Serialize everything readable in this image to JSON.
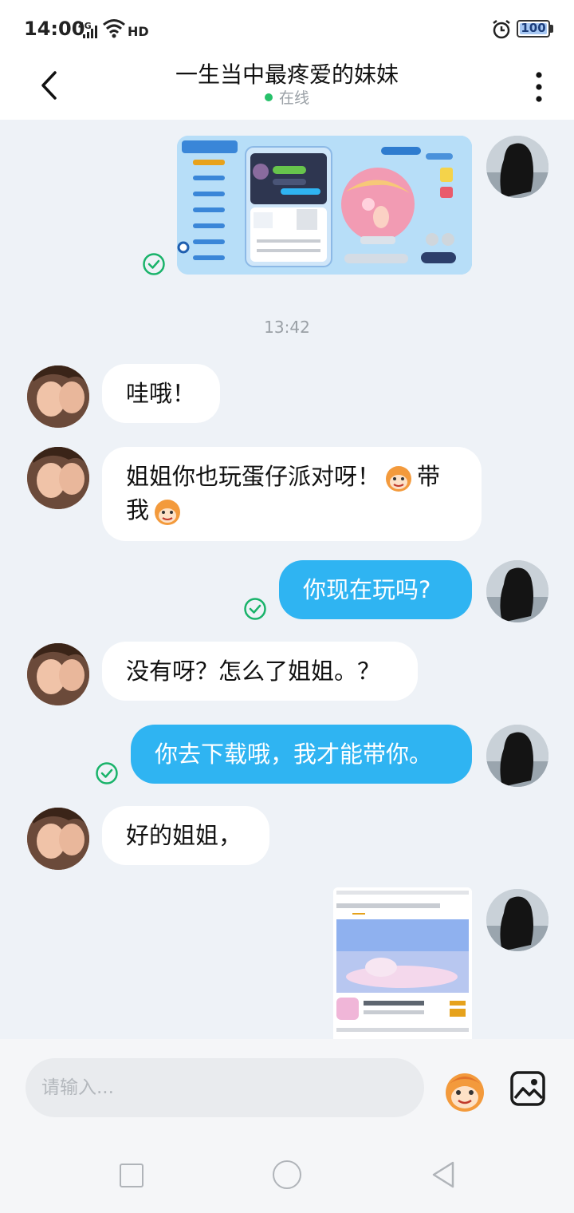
{
  "status_bar": {
    "time": "14:00",
    "network": "4G",
    "hd": "HD",
    "battery": "100"
  },
  "header": {
    "title": "一生当中最疼爱的妹妹",
    "status": "在线"
  },
  "timestamp": "13:42",
  "messages": [
    {
      "text": "哇哦！"
    },
    {
      "text_part1": "姐姐你也玩蛋仔派对呀！",
      "text_part2": "带",
      "text_part3": "我"
    },
    {
      "text": "你现在玩吗?"
    },
    {
      "text": "没有呀？怎么了姐姐。？"
    },
    {
      "text": "你去下载哦，我才能带你。"
    },
    {
      "text": "好的姐姐，"
    }
  ],
  "input": {
    "placeholder": "请输入..."
  },
  "icons": {
    "back": "chevron-left-icon",
    "more": "more-vertical-icon",
    "read": "check-circle-icon",
    "emoji": "monkey-emoji-icon",
    "image": "image-icon"
  },
  "colors": {
    "accent": "#2fb4f2",
    "check": "#19b36a",
    "online": "#27c16a"
  }
}
